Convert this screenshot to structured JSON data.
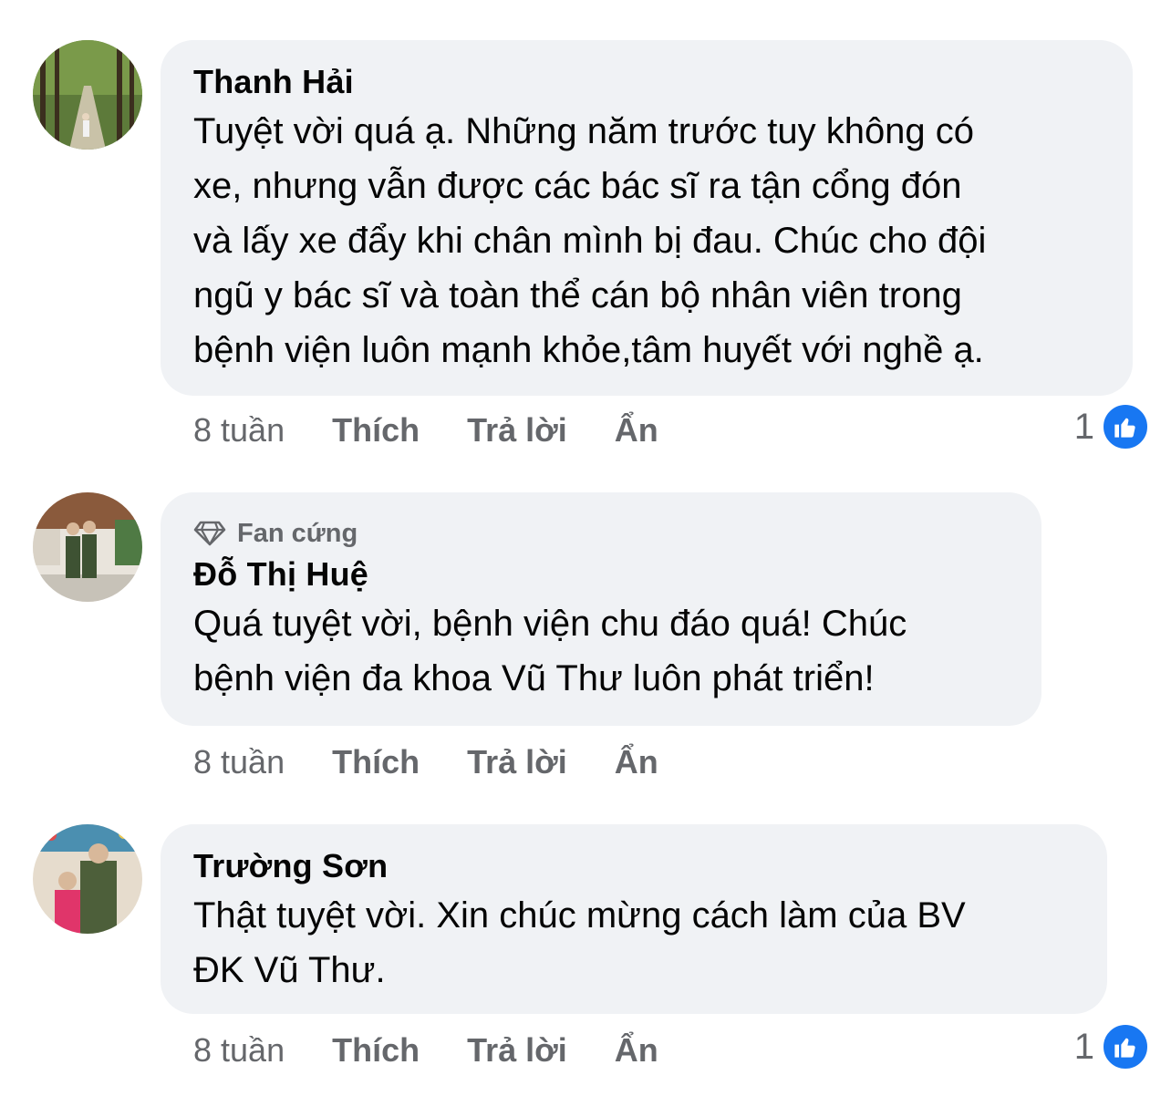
{
  "comments": [
    {
      "author": "Thanh Hải",
      "text": "Tuyệt vời quá ạ. Những năm trước tuy không có\nxe, nhưng vẫn được các bác sĩ ra tận cổng đón\nvà lấy xe đẩy khi chân mình bị đau. Chúc cho đội\nngũ y bác sĩ và toàn thể cán bộ nhân viên trong\nbệnh viện luôn mạnh khỏe,tâm huyết với nghề ạ.",
      "time": "8 tuần",
      "like_label": "Thích",
      "reply_label": "Trả lời",
      "hide_label": "Ẩn",
      "reaction_count": "1",
      "reaction_icon": "like-icon"
    },
    {
      "badge": "Fan cứng",
      "badge_icon": "diamond-icon",
      "author": "Đỗ Thị Huệ",
      "text": "Quá tuyệt vời, bệnh viện chu đáo quá! Chúc\nbệnh viện đa khoa Vũ Thư luôn phát triển!",
      "time": "8 tuần",
      "like_label": "Thích",
      "reply_label": "Trả lời",
      "hide_label": "Ẩn"
    },
    {
      "author": "Trường Sơn",
      "text": "Thật tuyệt vời. Xin chúc mừng cách làm của BV\nĐK Vũ Thư.",
      "time": "8 tuần",
      "like_label": "Thích",
      "reply_label": "Trả lời",
      "hide_label": "Ẩn",
      "reaction_count": "1",
      "reaction_icon": "like-icon"
    }
  ],
  "colors": {
    "bubble": "#f0f2f5",
    "meta_text": "#65676b",
    "like_blue": "#1877f2"
  }
}
